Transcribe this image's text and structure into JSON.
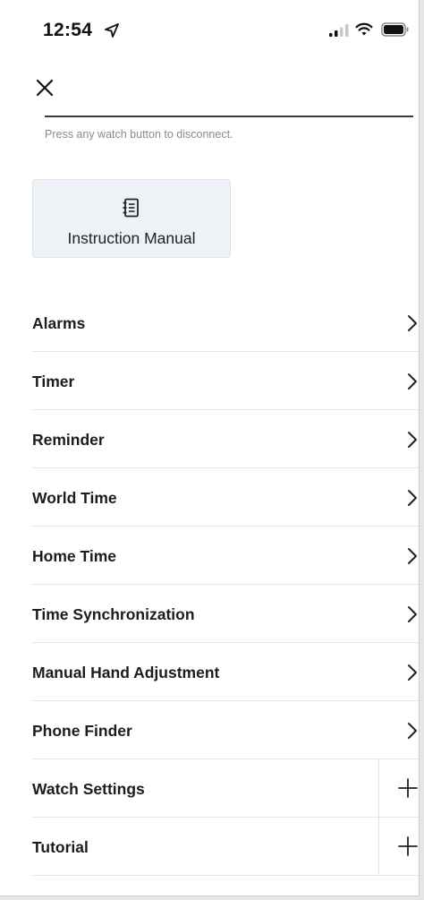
{
  "status_bar": {
    "time": "12:54",
    "location_icon": "location-arrow-icon",
    "signal_icon": "cellular-signal-icon",
    "wifi_icon": "wifi-icon",
    "battery_icon": "battery-icon"
  },
  "header": {
    "close_icon": "close-icon"
  },
  "hint": "Press any watch button to disconnect.",
  "manual_card": {
    "label": "Instruction Manual",
    "icon": "manual-book-icon"
  },
  "menu": {
    "items": [
      {
        "label": "Alarms",
        "action": "chevron"
      },
      {
        "label": "Timer",
        "action": "chevron"
      },
      {
        "label": "Reminder",
        "action": "chevron"
      },
      {
        "label": "World Time",
        "action": "chevron"
      },
      {
        "label": "Home Time",
        "action": "chevron"
      },
      {
        "label": "Time Synchronization",
        "action": "chevron"
      },
      {
        "label": "Manual Hand Adjustment",
        "action": "chevron"
      },
      {
        "label": "Phone Finder",
        "action": "chevron"
      },
      {
        "label": "Watch Settings",
        "action": "expand"
      },
      {
        "label": "Tutorial",
        "action": "expand"
      }
    ]
  },
  "colors": {
    "card_background": "#eef1f5",
    "text_primary": "#1c1c1c",
    "hint_text": "#8a8a8a"
  }
}
